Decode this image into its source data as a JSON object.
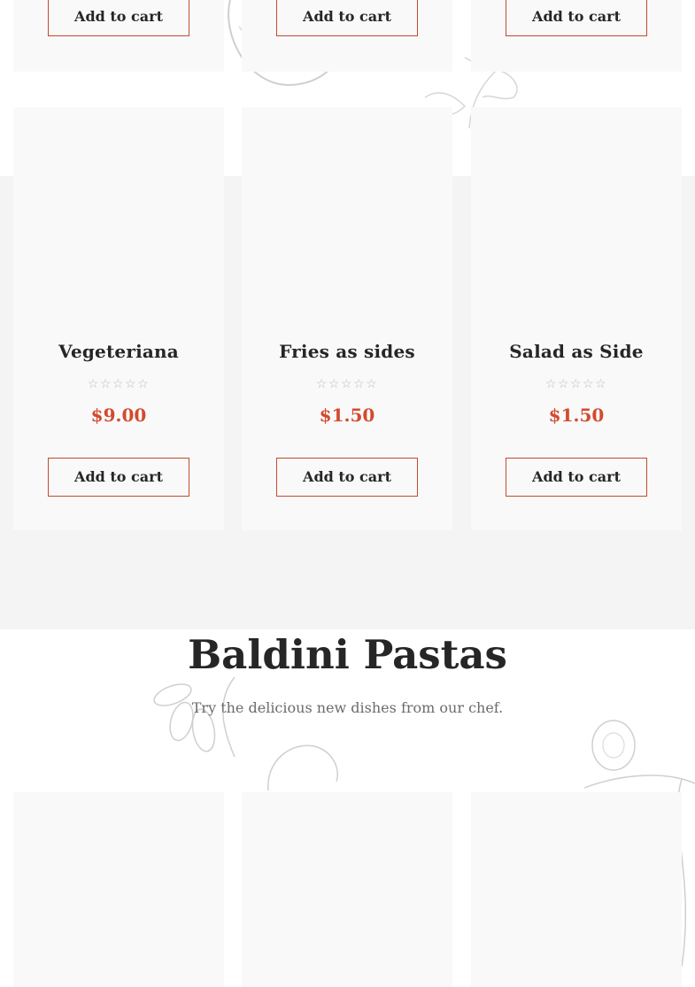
{
  "top_row": [
    {
      "button_label": "Add to cart"
    },
    {
      "button_label": "Add to cart"
    },
    {
      "button_label": "Add to cart"
    }
  ],
  "products": [
    {
      "name": "Vegeteriana",
      "rating_stars": "☆☆☆☆☆",
      "price": "$9.00",
      "button_label": "Add to cart"
    },
    {
      "name": "Fries as sides",
      "rating_stars": "☆☆☆☆☆",
      "price": "$1.50",
      "button_label": "Add to cart"
    },
    {
      "name": "Salad as Side",
      "rating_stars": "☆☆☆☆☆",
      "price": "$1.50",
      "button_label": "Add to cart"
    }
  ],
  "section": {
    "title": "Baldini Pastas",
    "subtitle": "Try the delicious new dishes from our chef."
  },
  "colors": {
    "accent": "#d34a2e",
    "button_border": "#c44a2f",
    "card_bg": "#f9f9f9",
    "band_bg": "#f4f4f5"
  },
  "decorations": [
    "tomato-sketch-icon",
    "herb-sketch-icon",
    "olive-branch-sketch-icon",
    "mushroom-sketch-icon",
    "lemon-sketch-icon",
    "basil-sketch-icon"
  ]
}
